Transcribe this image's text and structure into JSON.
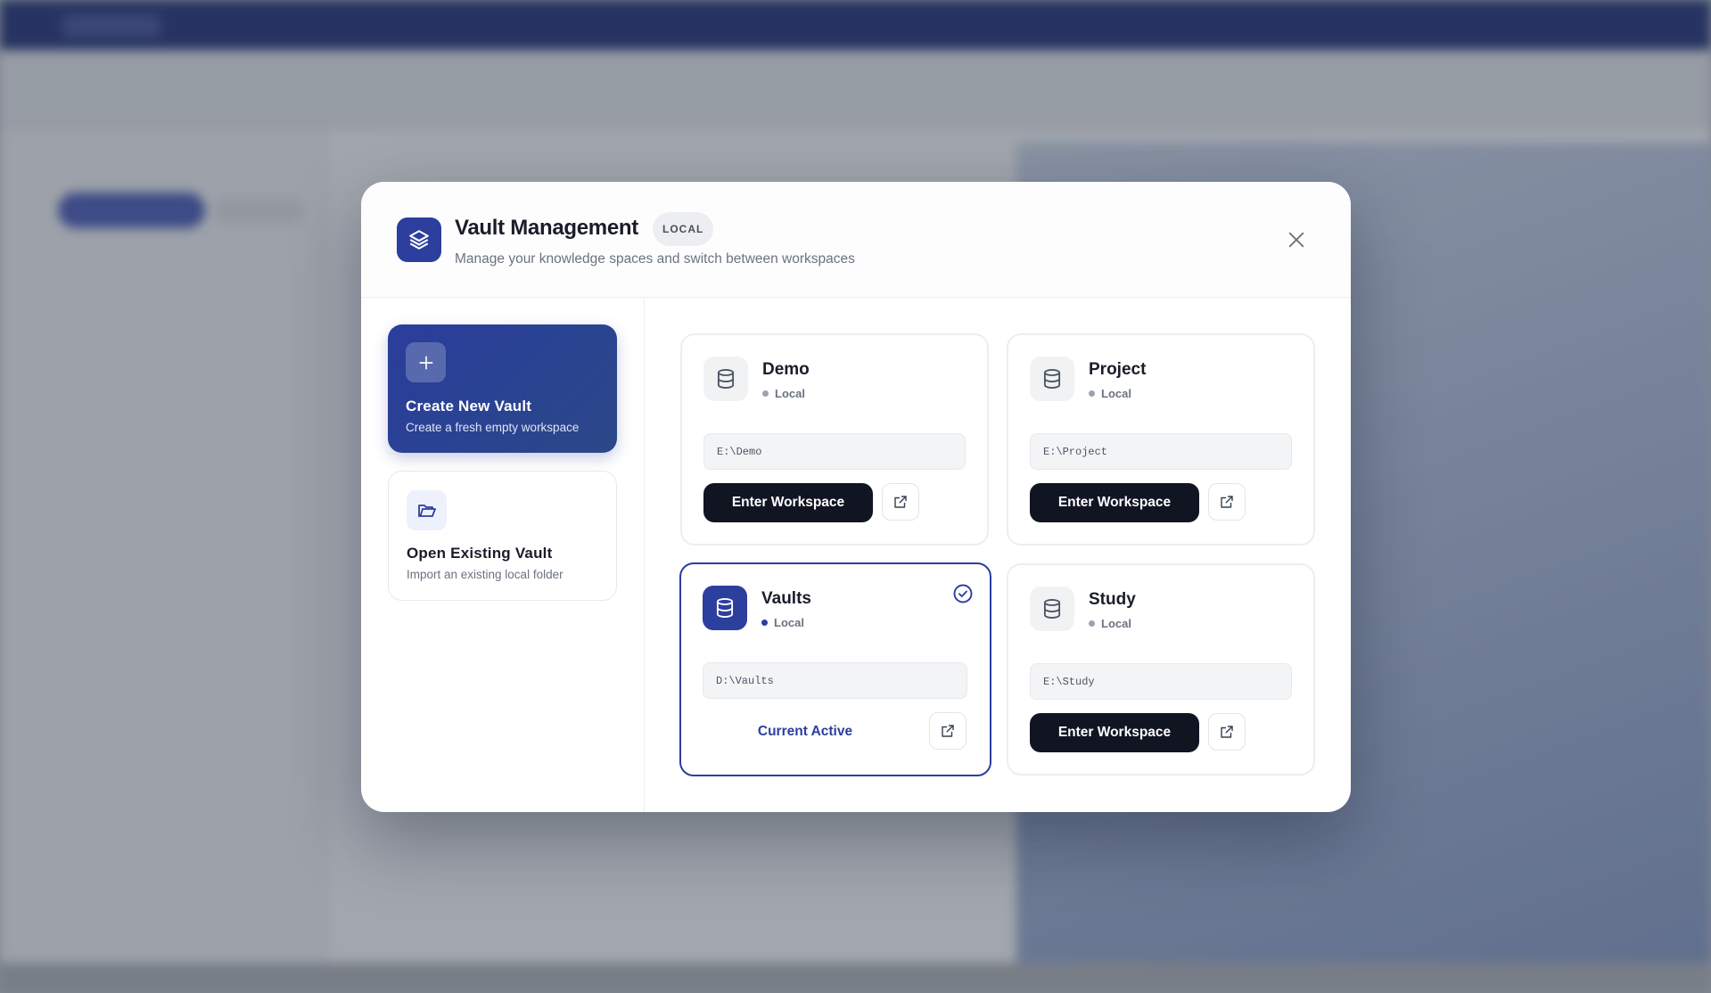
{
  "modal": {
    "title": "Vault Management",
    "badge": "LOCAL",
    "subtitle": "Manage your knowledge spaces and switch between workspaces"
  },
  "actions": {
    "create": {
      "title": "Create New Vault",
      "subtitle": "Create a fresh empty workspace"
    },
    "open": {
      "title": "Open Existing Vault",
      "subtitle": "Import an existing local folder"
    }
  },
  "vaults": [
    {
      "name": "Demo",
      "status": "Local",
      "path": "E:\\Demo",
      "button": "Enter Workspace",
      "active": false
    },
    {
      "name": "Project",
      "status": "Local",
      "path": "E:\\Project",
      "button": "Enter Workspace",
      "active": false
    },
    {
      "name": "Vaults",
      "status": "Local",
      "path": "D:\\Vaults",
      "button": "Current Active",
      "active": true
    },
    {
      "name": "Study",
      "status": "Local",
      "path": "E:\\Study",
      "button": "Enter Workspace",
      "active": false
    }
  ],
  "colors": {
    "accent": "#2c3e9e",
    "primary_button": "#111522",
    "status_inactive": "#9ca3af"
  }
}
